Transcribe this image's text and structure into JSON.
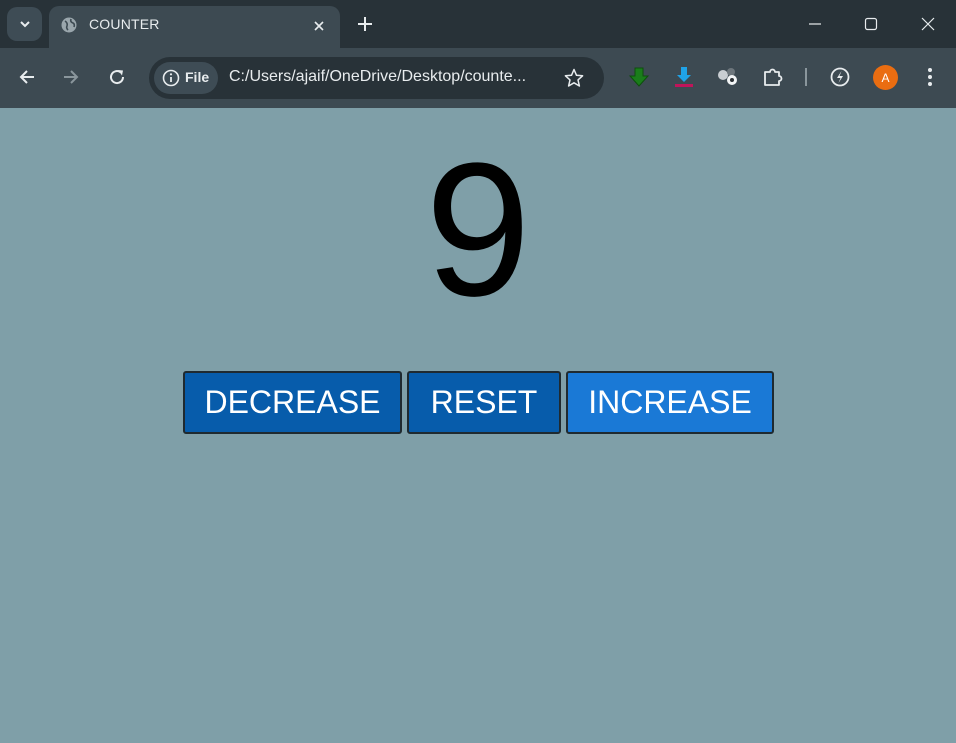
{
  "browser": {
    "tab": {
      "title": "COUNTER"
    },
    "omnibox": {
      "chip_label": "File",
      "url": "C:/Users/ajaif/OneDrive/Desktop/counte..."
    },
    "profile": {
      "initial": "A",
      "color": "#ea6d11"
    },
    "icons": [
      "tab-search-icon",
      "globe-icon",
      "close-icon",
      "plus-icon",
      "minimize-icon",
      "maximize-icon",
      "window-close-icon",
      "back-icon",
      "forward-icon",
      "reload-icon",
      "info-icon",
      "star-icon",
      "download-green-icon",
      "download-blue-icon",
      "extension-molecule-icon",
      "puzzle-icon",
      "performance-icon",
      "menu-icon"
    ]
  },
  "counter": {
    "value": "9",
    "buttons": {
      "decrease": "DECREASE",
      "reset": "RESET",
      "increase": "INCREASE"
    }
  },
  "colors": {
    "page_background": "#7f9fa8",
    "button_dark": "#075cab",
    "button_light": "#1a79d6"
  }
}
